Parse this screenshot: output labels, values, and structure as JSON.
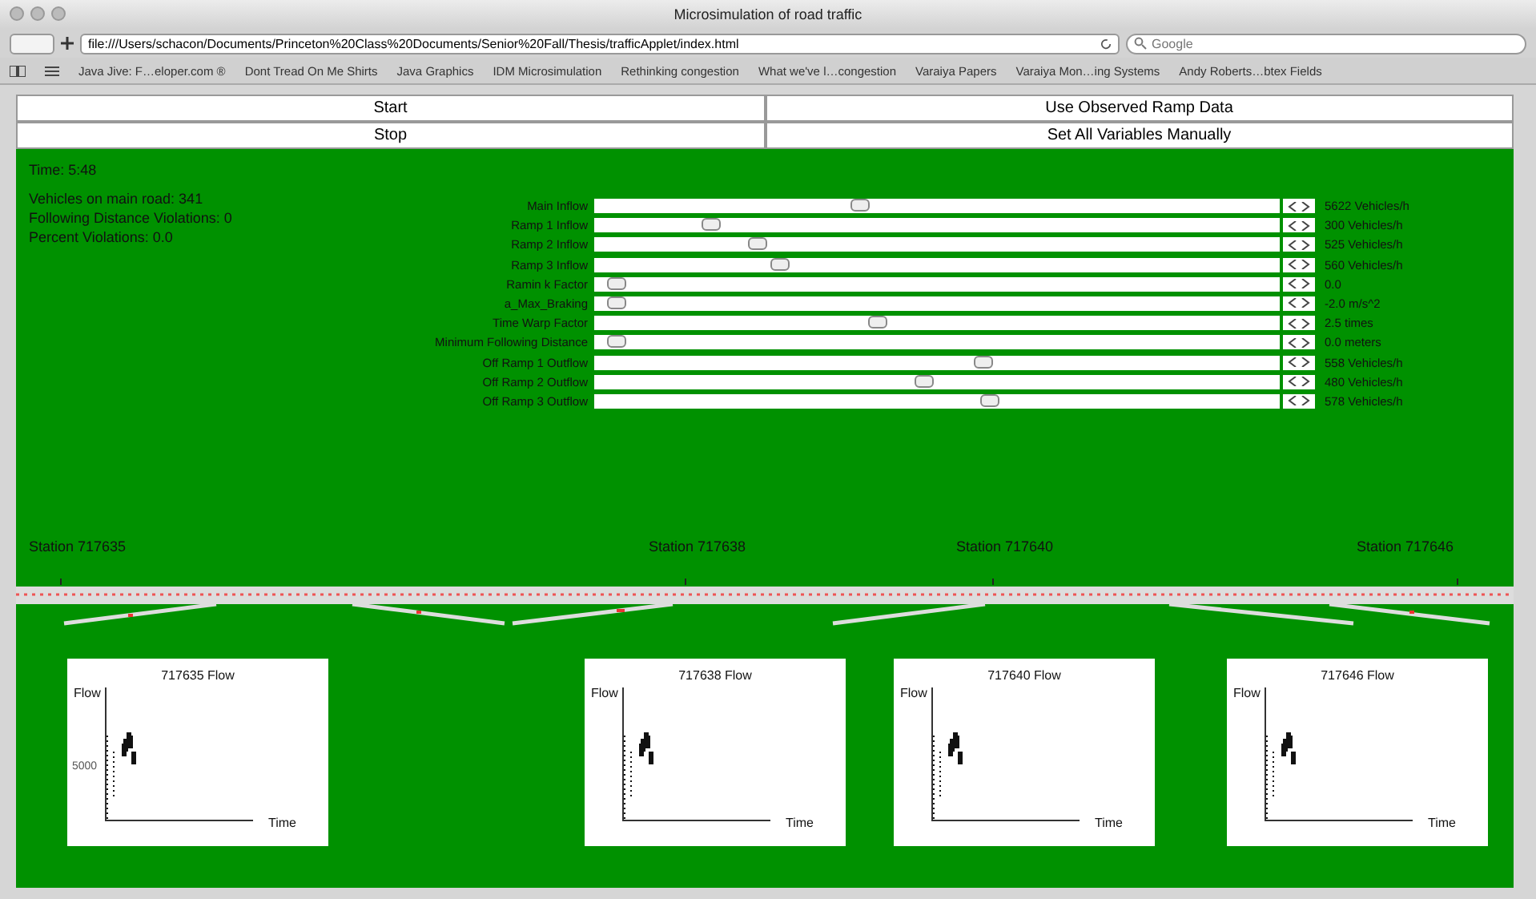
{
  "window": {
    "title": "Microsimulation of road traffic"
  },
  "toolbar": {
    "url": "file:///Users/schacon/Documents/Princeton%20Class%20Documents/Senior%20Fall/Thesis/trafficApplet/index.html",
    "search_placeholder": "Google"
  },
  "bookmarks": [
    "Java Jive: F…eloper.com ®",
    "Dont Tread On Me Shirts",
    "Java Graphics",
    "IDM Microsimulation",
    "Rethinking congestion",
    "What we've l…congestion",
    "Varaiya Papers",
    "Varaiya Mon…ing Systems",
    "Andy Roberts…btex Fields"
  ],
  "buttons": [
    [
      "Start",
      "Use Observed Ramp Data"
    ],
    [
      "Stop",
      "Set All Variables Manually"
    ]
  ],
  "time": "Time: 5:48",
  "stats": [
    "Vehicles on main road: 341",
    "Following Distance Violations: 0",
    "Percent Violations: 0.0"
  ],
  "sliders": [
    {
      "label": "Main Inflow",
      "level": 0.385,
      "reading": "5622 Vehicles/h"
    },
    {
      "label": "Ramp 1 Inflow",
      "level": 0.16,
      "reading": "300 Vehicles/h"
    },
    {
      "label": "Ramp 2 Inflow",
      "level": 0.23,
      "reading": "525 Vehicles/h"
    },
    {
      "label": "Ramp 3 Inflow",
      "level": 0.265,
      "reading": "560 Vehicles/h"
    },
    {
      "label": "Ramin k Factor",
      "level": 0.02,
      "reading": "0.0"
    },
    {
      "label": "a_Max_Braking",
      "level": 0.02,
      "reading": "-2.0 m/s^2"
    },
    {
      "label": "Time Warp Factor",
      "level": 0.41,
      "reading": "2.5 times"
    },
    {
      "label": "Minimum Following Distance",
      "level": 0.02,
      "reading": "0.0 meters"
    },
    {
      "label": "Off Ramp 1 Outflow",
      "level": 0.57,
      "reading": "558 Vehicles/h"
    },
    {
      "label": "Off Ramp 2 Outflow",
      "level": 0.48,
      "reading": "480 Vehicles/h"
    },
    {
      "label": "Off Ramp 3 Outflow",
      "level": 0.58,
      "reading": "578 Vehicles/h"
    }
  ],
  "stations": [
    "Station 717635",
    "Station 717638",
    "Station 717640",
    "Station 717646"
  ],
  "charts": [
    {
      "title": "717635 Flow",
      "ylabel": "Flow",
      "xlabel": "Time",
      "tick": "5000"
    },
    {
      "title": "717638 Flow",
      "ylabel": "Flow",
      "xlabel": "Time"
    },
    {
      "title": "717640 Flow",
      "ylabel": "Flow",
      "xlabel": "Time"
    },
    {
      "title": "717646 Flow",
      "ylabel": "Flow",
      "xlabel": "Time"
    }
  ]
}
